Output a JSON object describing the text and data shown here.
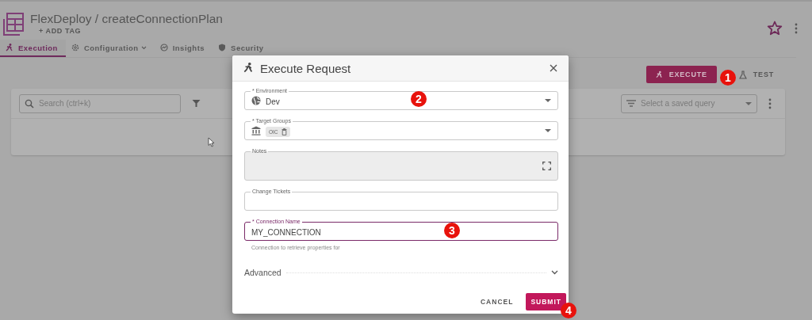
{
  "header": {
    "title": "FlexDeploy / createConnectionPlan",
    "add_tag": "+ ADD TAG",
    "favorite": false
  },
  "tabs": [
    {
      "label": "Execution",
      "selected": true,
      "dropdown": false
    },
    {
      "label": "Configuration",
      "selected": false,
      "dropdown": true
    },
    {
      "label": "Insights",
      "selected": false,
      "dropdown": false
    },
    {
      "label": "Security",
      "selected": false,
      "dropdown": false
    }
  ],
  "actions": [
    {
      "label": "EXECUTE",
      "kind": "primary"
    },
    {
      "label": "TEST",
      "kind": "text"
    }
  ],
  "search": {
    "placeholder": "Search (ctrl+k)"
  },
  "saved_query": {
    "placeholder": "Select a saved query"
  },
  "dialog": {
    "title": "Execute Request",
    "fields": [
      {
        "label": "* Environment",
        "kind": "environment",
        "value": "Dev",
        "focused": false,
        "disabled": false
      },
      {
        "label": "* Target Groups",
        "kind": "groups",
        "chips": [
          "OIC"
        ],
        "focused": false,
        "disabled": false
      },
      {
        "label": "Notes",
        "kind": "notes",
        "focused": false,
        "disabled": true
      },
      {
        "label": "Change Tickets",
        "kind": "text",
        "focused": false,
        "disabled": false
      },
      {
        "label": "* Connection Name",
        "kind": "text",
        "value": "MY_CONNECTION",
        "hint": "Connection to retrieve properties for",
        "focused": true,
        "disabled": false
      }
    ],
    "advanced": {
      "label": "Advanced",
      "expanded": false
    },
    "buttons": [
      {
        "label": "CANCEL",
        "kind": "text"
      },
      {
        "label": "SUBMIT",
        "kind": "primary"
      }
    ]
  },
  "callouts": [
    "1",
    "2",
    "3",
    "4"
  ]
}
